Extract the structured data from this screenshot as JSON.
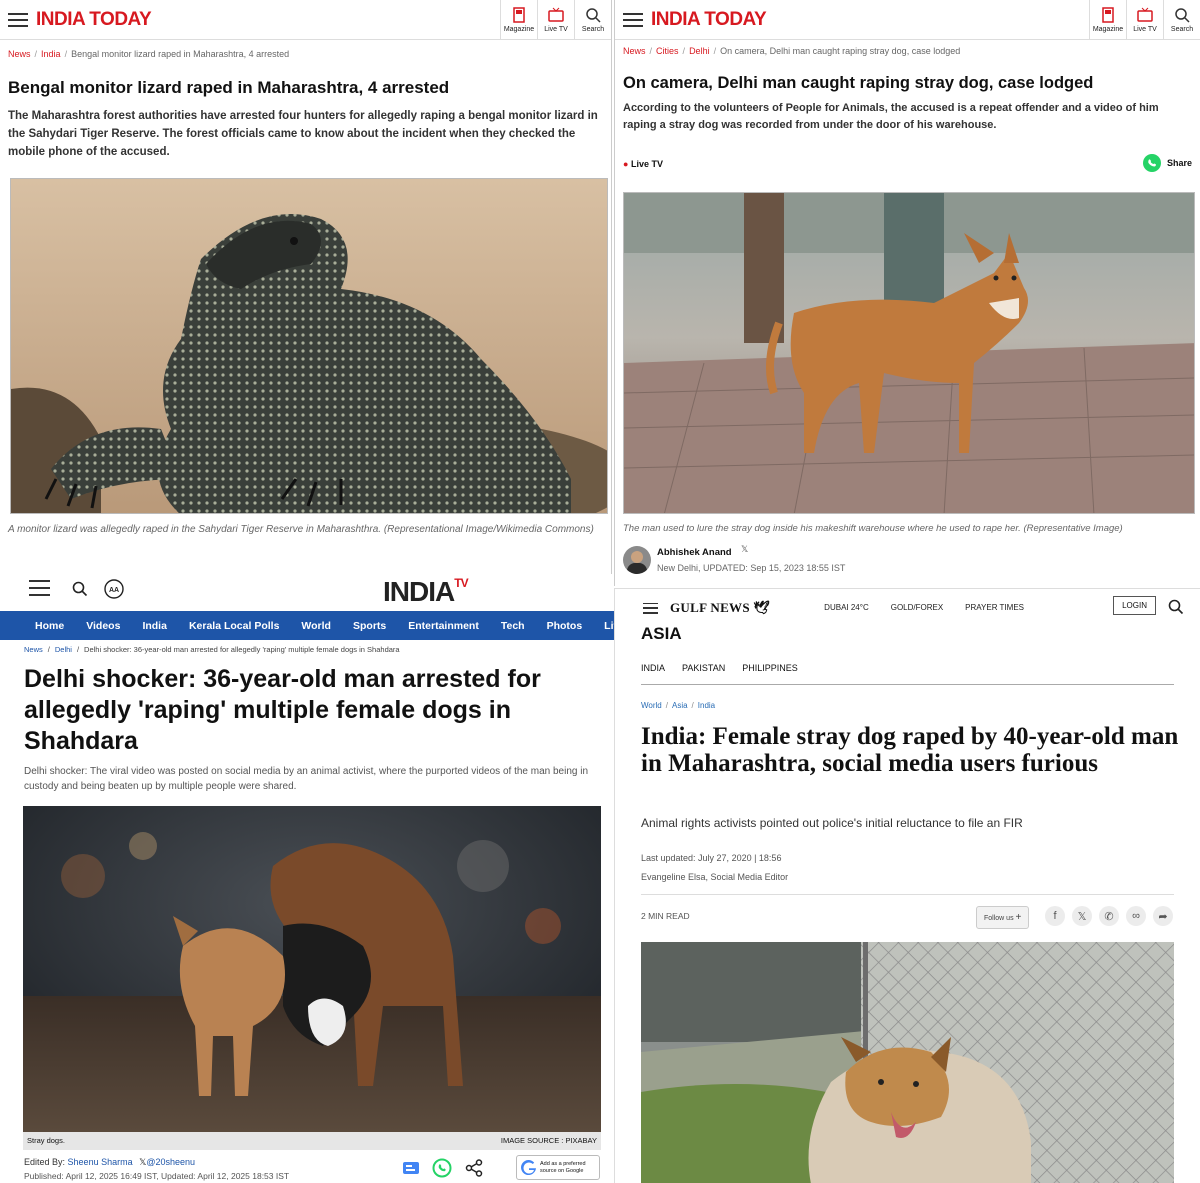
{
  "panel1": {
    "logo": "INDIA TODAY",
    "tools": [
      "Magazine",
      "Live TV",
      "Search"
    ],
    "breadcrumb": [
      "News",
      "India",
      "Bengal monitor lizard raped in Maharashtra, 4 arrested"
    ],
    "headline": "Bengal monitor lizard raped in Maharashtra, 4 arrested",
    "summary": "The Maharashtra forest authorities have arrested four hunters for allegedly raping a bengal monitor lizard in the Sahydari Tiger Reserve. The forest officials came to know about the incident when they checked the mobile phone of the accused.",
    "caption": "A monitor lizard was allegedly raped in the Sahydari Tiger Reserve in Maharashthra. (Representational Image/Wikimedia Commons)"
  },
  "panel2": {
    "logo": "INDIA TODAY",
    "tools": [
      "Magazine",
      "Live TV",
      "Search"
    ],
    "breadcrumb": [
      "News",
      "Cities",
      "Delhi",
      "On camera, Delhi man caught raping stray dog, case lodged"
    ],
    "headline": "On camera, Delhi man caught raping stray dog, case lodged",
    "summary": "According to the volunteers of People for Animals, the accused is a repeat offender and a video of him raping a stray dog was recorded from under the door of his warehouse.",
    "live_tv": "Live TV",
    "share": "Share",
    "caption": "The man used to lure the stray dog inside his makeshift warehouse where he used to rape her. (Representative Image)",
    "author": "Abhishek Anand",
    "dateline": "New Delhi, UPDATED: Sep 15, 2023 18:55 IST"
  },
  "panel3": {
    "logo": "INDIA",
    "logo_suffix": "TV",
    "nav": [
      "Home",
      "Videos",
      "India",
      "Kerala Local Polls",
      "World",
      "Sports",
      "Entertainment",
      "Tech",
      "Photos",
      "Life"
    ],
    "breadcrumb": [
      "News",
      "Delhi",
      "Delhi shocker: 36-year-old man arrested for allegedly 'raping' multiple female dogs in Shahdara"
    ],
    "headline": "Delhi shocker: 36-year-old man arrested for allegedly 'raping' multiple female dogs in Shahdara",
    "summary": "Delhi shocker: The viral video was posted on social media by an animal activist, where the purported videos of the man being in custody and being beaten up by multiple people were shared.",
    "caption": "Stray dogs.",
    "image_source": "IMAGE SOURCE : PIXABAY",
    "edited_by_label": "Edited By:",
    "editor": "Sheenu Sharma",
    "editor_handle": "@20sheenu",
    "published": "Published: April 12, 2025 16:49 IST, Updated: April 12, 2025 18:53 IST",
    "google_badge": "Add as a preferred source on Google"
  },
  "panel4": {
    "logo": "GULF NEWS",
    "menu": [
      "DUBAI 24°C",
      "GOLD/FOREX",
      "PRAYER TIMES"
    ],
    "login": "LOGIN",
    "section": "ASIA",
    "tabs": [
      "INDIA",
      "PAKISTAN",
      "PHILIPPINES"
    ],
    "breadcrumb": [
      "World",
      "Asia",
      "India"
    ],
    "headline": "India: Female stray dog raped by 40-year-old man in Maharashtra, social media users furious",
    "summary": "Animal rights activists pointed out police's initial reluctance to file an FIR",
    "updated": "Last updated: July 27, 2020 | 18:56",
    "author": "Evangeline Elsa, Social Media Editor",
    "read_time": "2 MIN READ",
    "follow": "Follow us"
  }
}
